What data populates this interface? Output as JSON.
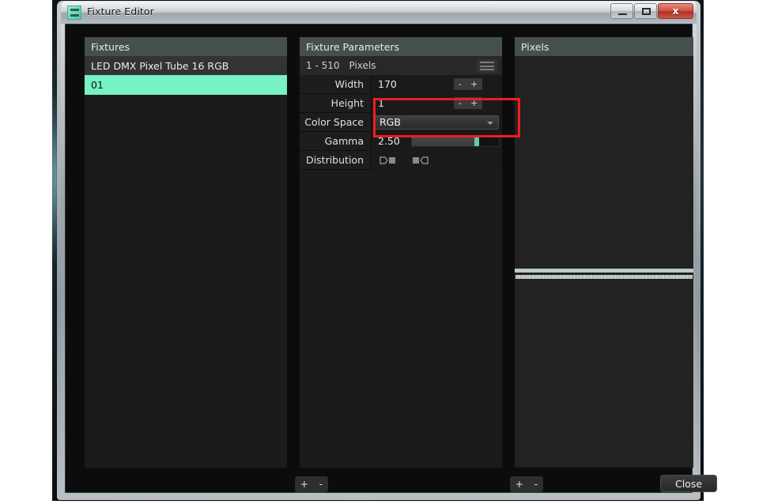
{
  "window": {
    "title": "Fixture Editor",
    "icon": "app-logo-icon",
    "buttons": {
      "minimize": "minimize-icon",
      "maximize": "maximize-icon",
      "close": "x"
    }
  },
  "fixtures": {
    "header": "Fixtures",
    "rows": [
      {
        "label": "LED DMX Pixel Tube 16 RGB",
        "type": "group",
        "selected": false
      },
      {
        "label": "01",
        "type": "item",
        "selected": true
      }
    ],
    "footer": {
      "add": "+",
      "remove": "-"
    }
  },
  "parameters": {
    "header": "Fixture Parameters",
    "subheader": {
      "range": "1 - 510",
      "label": "Pixels",
      "menu_icon": "hamburger-menu-icon"
    },
    "rows": [
      {
        "label": "Width",
        "value": "170",
        "control": "spinner",
        "dec": "-",
        "inc": "+"
      },
      {
        "label": "Height",
        "value": "1",
        "control": "spinner",
        "dec": "-",
        "inc": "+"
      },
      {
        "label": "Color Space",
        "value": "RGB",
        "control": "combo"
      },
      {
        "label": "Gamma",
        "value": "2.50",
        "control": "slider",
        "slider_percent": 72
      },
      {
        "label": "Distribution",
        "value": "",
        "control": "distribution"
      }
    ],
    "distribution_options": [
      "distribution-start-left-icon",
      "distribution-start-right-icon"
    ],
    "footer": {
      "add": "+",
      "remove": "-"
    }
  },
  "pixels": {
    "header": "Pixels",
    "strip_cells": 170
  },
  "footer": {
    "close_label": "Close"
  },
  "colors": {
    "selection_green": "#76f2c4",
    "annotation_red": "#ef1d1d",
    "panel_header": "#454f4c",
    "slider_handle": "#68c9a4"
  }
}
